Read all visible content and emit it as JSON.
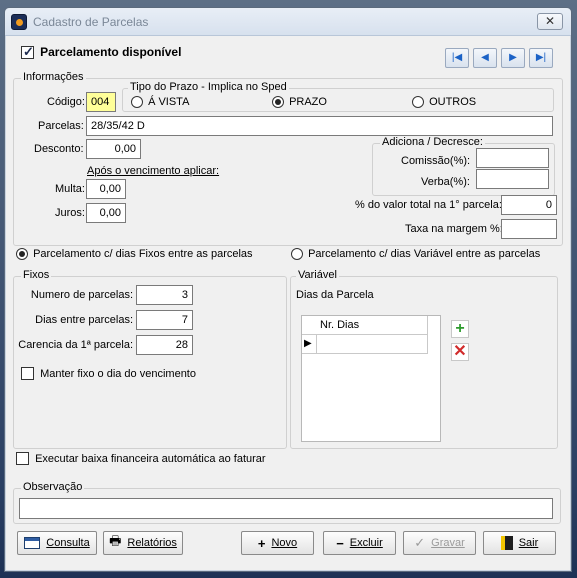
{
  "window": {
    "title": "Cadastro de Parcelas",
    "close_label": "✕"
  },
  "header": {
    "parcelamento_disponivel_label": "Parcelamento disponível",
    "parcelamento_disponivel_checked": true
  },
  "nav": {
    "first": "|◀",
    "prev": "◀",
    "next": "▶",
    "last": "▶|"
  },
  "informacoes": {
    "title": "Informações",
    "codigo_label": "Código:",
    "codigo_value": "004",
    "tipo_prazo": {
      "title": "Tipo do Prazo - Implica no Sped",
      "options": [
        "Á VISTA",
        "PRAZO",
        "OUTROS"
      ],
      "selected": "PRAZO"
    },
    "parcelas_label": "Parcelas:",
    "parcelas_value": "28/35/42 D",
    "desconto_label": "Desconto:",
    "desconto_value": "0,00",
    "apos_vencimento_label": "Após o vencimento aplicar:",
    "multa_label": "Multa:",
    "multa_value": "0,00",
    "juros_label": "Juros:",
    "juros_value": "0,00",
    "adiciona": {
      "title": "Adiciona / Decresce:",
      "comissao_label": "Comissão(%):",
      "comissao_value": "",
      "verba_label": "Verba(%):",
      "verba_value": ""
    },
    "pct_valor_total_label": "% do valor total na 1° parcela:",
    "pct_valor_total_value": "0",
    "taxa_margem_label": "Taxa na margem %:",
    "taxa_margem_value": ""
  },
  "modo": {
    "fixos_label": "Parcelamento c/ dias Fixos entre as parcelas",
    "variavel_label": "Parcelamento c/ dias Variável entre as parcelas",
    "selected": "fixos"
  },
  "fixos": {
    "title": "Fixos",
    "numero_parcelas_label": "Numero de parcelas:",
    "numero_parcelas_value": "3",
    "dias_entre_label": "Dias entre parcelas:",
    "dias_entre_value": "7",
    "carencia_label": "Carencia da 1ª parcela:",
    "carencia_value": "28",
    "manter_fixo_label": "Manter fixo o dia do vencimento",
    "manter_fixo_checked": false
  },
  "variavel": {
    "title": "Variável",
    "dias_parcela_label": "Dias da Parcela",
    "grid_header": "Nr. Dias",
    "row_indicator": "▶"
  },
  "baixa": {
    "label": "Executar baixa financeira automática ao faturar",
    "checked": false
  },
  "observacao": {
    "title": "Observação",
    "value": ""
  },
  "buttons": {
    "consulta": "Consulta",
    "relatorios": "Relatórios",
    "novo": "Novo",
    "excluir": "Excluir",
    "gravar": "Gravar",
    "sair": "Sair"
  }
}
